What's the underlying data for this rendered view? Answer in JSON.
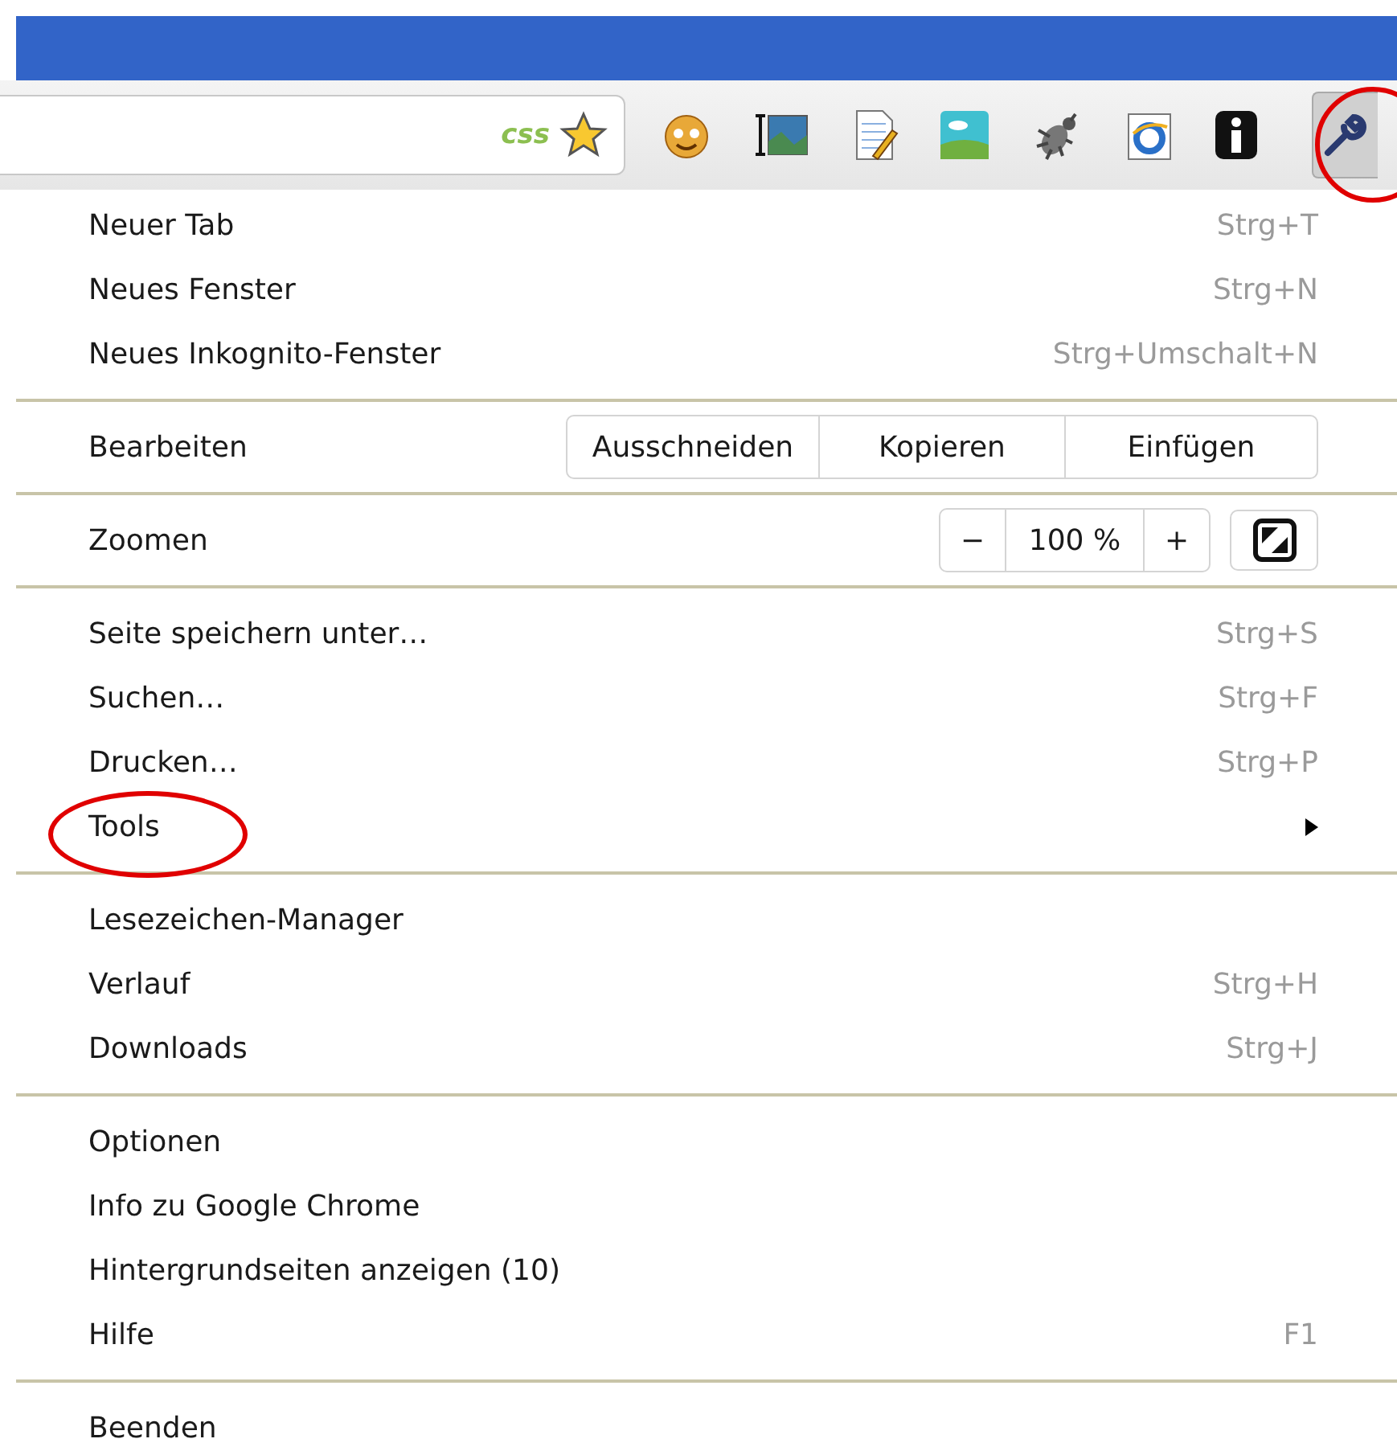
{
  "toolbar": {
    "address_badge": "css",
    "menu_button": {
      "highlighted": true
    }
  },
  "menu": {
    "sections": [
      {
        "items": [
          {
            "kind": "command",
            "label": "Neuer Tab",
            "shortcut": "Strg+T",
            "submenu": false,
            "highlighted": false
          },
          {
            "kind": "command",
            "label": "Neues Fenster",
            "shortcut": "Strg+N",
            "submenu": false,
            "highlighted": false
          },
          {
            "kind": "command",
            "label": "Neues Inkognito-Fenster",
            "shortcut": "Strg+Umschalt+N",
            "submenu": false,
            "highlighted": false
          }
        ]
      },
      {
        "items": [
          {
            "kind": "edit",
            "label": "Bearbeiten",
            "buttons": [
              "Ausschneiden",
              "Kopieren",
              "Einfügen"
            ]
          }
        ]
      },
      {
        "items": [
          {
            "kind": "zoom",
            "label": "Zoomen",
            "minus": "−",
            "level_text": "100 %",
            "plus": "+"
          }
        ]
      },
      {
        "items": [
          {
            "kind": "command",
            "label": "Seite speichern unter…",
            "shortcut": "Strg+S",
            "submenu": false,
            "highlighted": false
          },
          {
            "kind": "command",
            "label": "Suchen…",
            "shortcut": "Strg+F",
            "submenu": false,
            "highlighted": false
          },
          {
            "kind": "command",
            "label": "Drucken…",
            "shortcut": "Strg+P",
            "submenu": false,
            "highlighted": false
          },
          {
            "kind": "command",
            "label": "Tools",
            "submenu": true,
            "highlighted": true
          }
        ]
      },
      {
        "items": [
          {
            "kind": "command",
            "label": "Lesezeichen-Manager",
            "submenu": false,
            "highlighted": false
          },
          {
            "kind": "command",
            "label": "Verlauf",
            "shortcut": "Strg+H",
            "submenu": false,
            "highlighted": false
          },
          {
            "kind": "command",
            "label": "Downloads",
            "shortcut": "Strg+J",
            "submenu": false,
            "highlighted": false
          }
        ]
      },
      {
        "items": [
          {
            "kind": "command",
            "label": "Optionen",
            "submenu": false,
            "highlighted": false
          },
          {
            "kind": "command",
            "label": "Info zu Google Chrome",
            "submenu": false,
            "highlighted": false
          },
          {
            "kind": "command",
            "label": "Hintergrundseiten anzeigen (10)",
            "submenu": false,
            "highlighted": false
          },
          {
            "kind": "command",
            "label": "Hilfe",
            "shortcut": "F1",
            "submenu": false,
            "highlighted": false
          }
        ]
      },
      {
        "items": [
          {
            "kind": "command",
            "label": "Beenden",
            "submenu": false,
            "highlighted": false
          }
        ]
      }
    ]
  }
}
